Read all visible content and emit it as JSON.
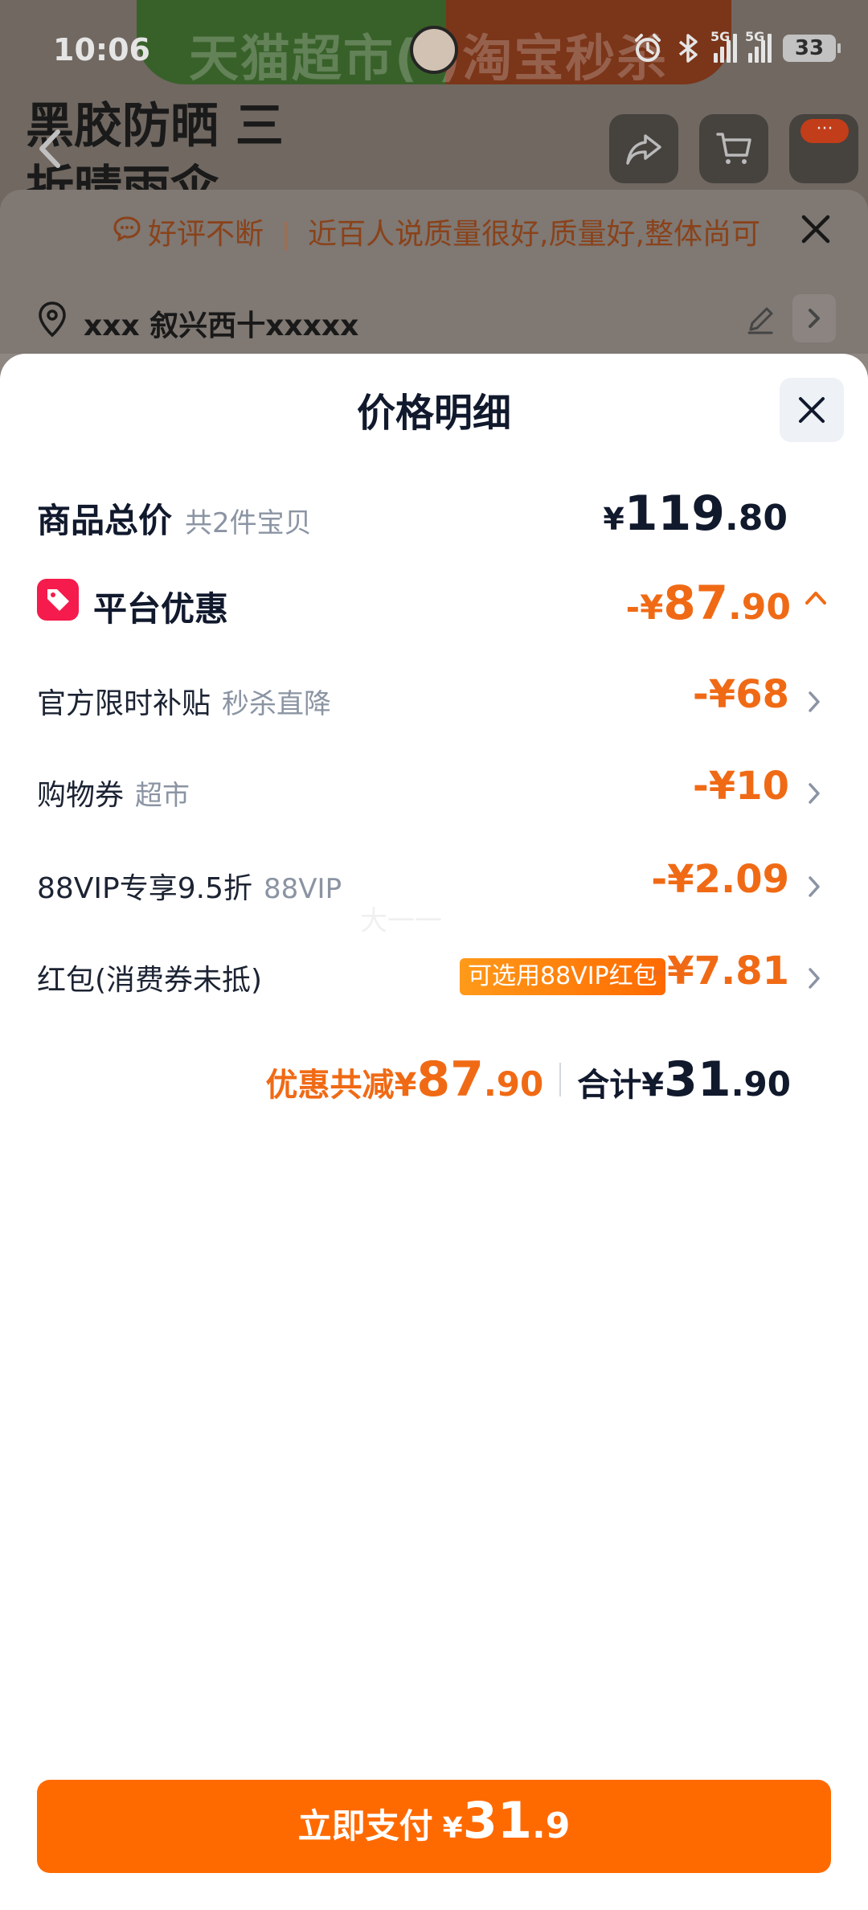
{
  "status_bar": {
    "time": "10:06",
    "signal_tag_1": "5G",
    "signal_tag_2": "5G",
    "battery": "33"
  },
  "background": {
    "banner_text": "天猫超市(   )淘宝秒杀",
    "product_title": "黑胶防晒 三折晴雨伞",
    "cart_badge": "···",
    "review_tag": "好评不断",
    "review_text": "近百人说质量很好,质量好,整体尚可",
    "address": "xxx 叙兴西十xxxxx"
  },
  "sheet": {
    "title": "价格明细",
    "total": {
      "label": "商品总价",
      "sub": "共2件宝贝",
      "currency": "¥",
      "int": "119",
      "dec": ".80"
    },
    "platform_discount": {
      "label": "平台优惠",
      "prefix": "-¥",
      "int": "87",
      "dec": ".90"
    },
    "items": [
      {
        "label": "官方限时补贴",
        "sub": "秒杀直降",
        "amount": "-¥68"
      },
      {
        "label": "购物券",
        "sub": "超市",
        "amount": "-¥10"
      },
      {
        "label": "88VIP专享9.5折",
        "sub": "88VIP",
        "amount": "-¥2.09"
      },
      {
        "label": "红包(消费券未抵)",
        "sub": "",
        "amount": "-¥7.81",
        "pill": "可选用88VIP红包"
      }
    ],
    "summary": {
      "discount_label": "优惠共减",
      "discount_currency": "¥",
      "discount_int": "87",
      "discount_dec": ".90",
      "total_label": "合计",
      "total_currency": "¥",
      "total_int": "31",
      "total_dec": ".90"
    },
    "watermark": "大一一"
  },
  "pay_button": {
    "label": "立即支付",
    "currency": "¥",
    "int": "31",
    "dec": ".9"
  },
  "colors": {
    "accent_orange": "#ff6a00",
    "discount_orange": "#f06a15",
    "tag_red": "#f51b4c",
    "text_dark": "#11192d"
  }
}
